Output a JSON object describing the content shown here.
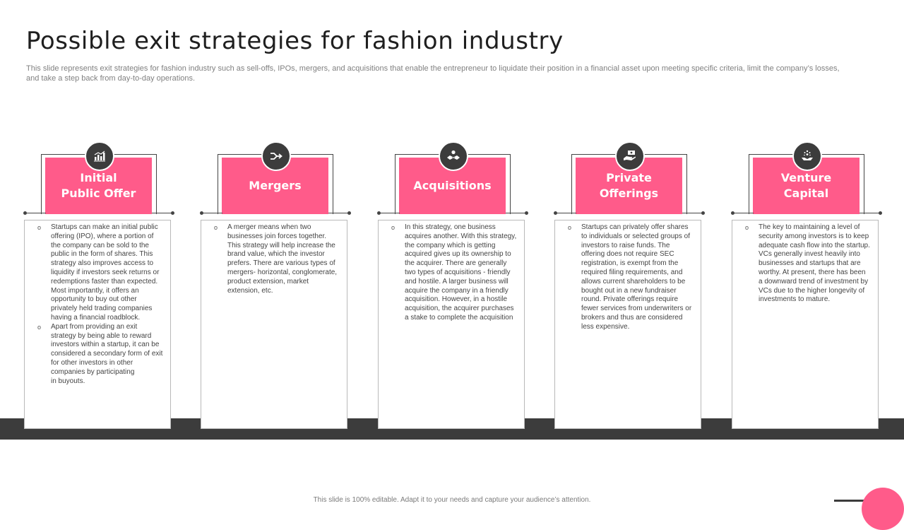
{
  "slide": {
    "title": "Possible exit strategies for fashion industry",
    "subtitle": "This slide represents exit strategies for fashion industry such as sell-offs, IPOs, mergers, and acquisitions that enable the entrepreneur to liquidate their position in a financial asset upon meeting specific criteria, limit the company’s losses, and take a step back from day-to-day operations.",
    "footer": "This slide is 100% editable.  Adapt it to your needs and capture your audience’s attention.",
    "accent_color": "#ff5b8a",
    "dark_color": "#3c3c3c"
  },
  "cards": [
    {
      "heading": "Initial\nPublic Offer",
      "icon": "bar-chart-icon",
      "bullets": [
        "Startups can make an initial public offering (IPO), where a portion of the company can be sold to the public in the form of shares. This strategy also improves access to liquidity if investors seek returns or redemptions faster than expected. Most importantly, it offers an opportunity to buy out other privately held trading companies having a financial roadblock.",
        "Apart from providing an exit strategy by being able to reward investors within a startup, it can be considered a secondary form of exit for other investors in other companies by participating\n in buyouts."
      ]
    },
    {
      "heading": "Mergers",
      "icon": "merge-arrow-icon",
      "bullets": [
        "A merger means when two businesses join forces together. This strategy will help increase the brand value, which the investor prefers. There are various types of mergers- horizontal, conglomerate, product extension, market extension, etc."
      ]
    },
    {
      "heading": "Acquisitions",
      "icon": "handshake-icon",
      "bullets": [
        "In this strategy, one business acquires another. With this strategy, the company which is getting acquired gives up its ownership to the acquirer. There are generally two types of acquisitions - friendly and hostile. A larger business will acquire the company in a friendly acquisition. However, in a hostile acquisition, the acquirer purchases a stake to complete the acquisition"
      ]
    },
    {
      "heading": "Private\nOfferings",
      "icon": "hand-money-icon",
      "bullets": [
        "Startups can privately offer shares to individuals or selected groups of investors to raise funds. The offering does not require SEC registration, is exempt from the required filing requirements, and allows current shareholders to be bought out in a new fundraiser round. Private offerings require fewer services from underwriters or brokers and thus are considered less expensive."
      ]
    },
    {
      "heading": "Venture\nCapital",
      "icon": "hand-growth-icon",
      "bullets": [
        "The key to maintaining a level of security among investors is to keep adequate cash flow into the startup. VCs generally invest heavily into businesses and startups that are worthy. At present, there has been a downward trend of investment by VCs due to the higher longevity of investments to mature."
      ]
    }
  ]
}
